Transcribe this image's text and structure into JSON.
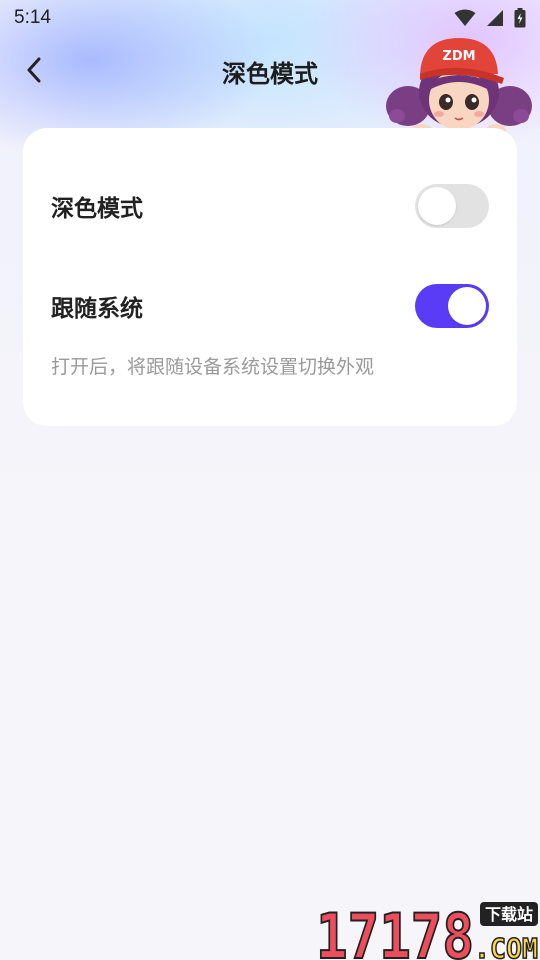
{
  "status_bar": {
    "time": "5:14"
  },
  "header": {
    "title": "深色模式"
  },
  "settings": {
    "dark_mode": {
      "label": "深色模式",
      "enabled": false
    },
    "follow_system": {
      "label": "跟随系统",
      "enabled": true
    },
    "hint": "打开后，将跟随设备系统设置切换外观"
  },
  "mascot": {
    "cap_text": "ZDM"
  },
  "watermark": {
    "number": "17178",
    "tag": "下载站",
    "domain": ".COM"
  },
  "colors": {
    "accent": "#5b3cf6",
    "toggle_off": "#e2e2e2",
    "card": "#ffffff"
  }
}
